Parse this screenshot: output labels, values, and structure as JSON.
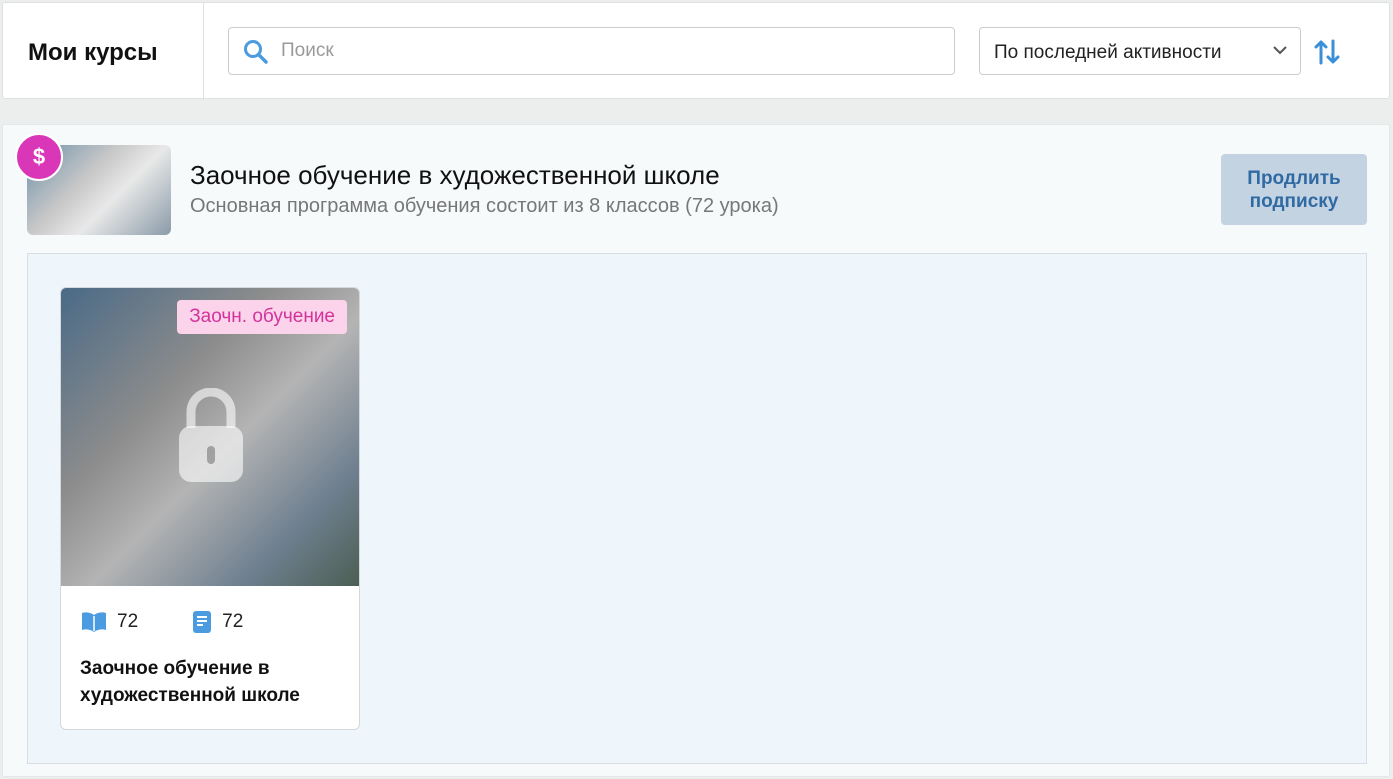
{
  "header": {
    "title": "Мои курсы",
    "search_placeholder": "Поиск",
    "sort_selected": "По последней активности"
  },
  "course": {
    "title": "Заочное обучение в художественной школе",
    "subtitle": "Основная программа обучения состоит из 8 классов (72 урока)",
    "renew_label": "Продлить подписку",
    "badge_icon": "subscription-dollar-icon",
    "card": {
      "tag": "Заочн. обучение",
      "lessons": "72",
      "tasks": "72",
      "name": "Заочное обучение в художественной школе"
    }
  },
  "colors": {
    "accent": "#3a8fd9",
    "badge": "#d936b8",
    "tag_text": "#d4339b"
  }
}
